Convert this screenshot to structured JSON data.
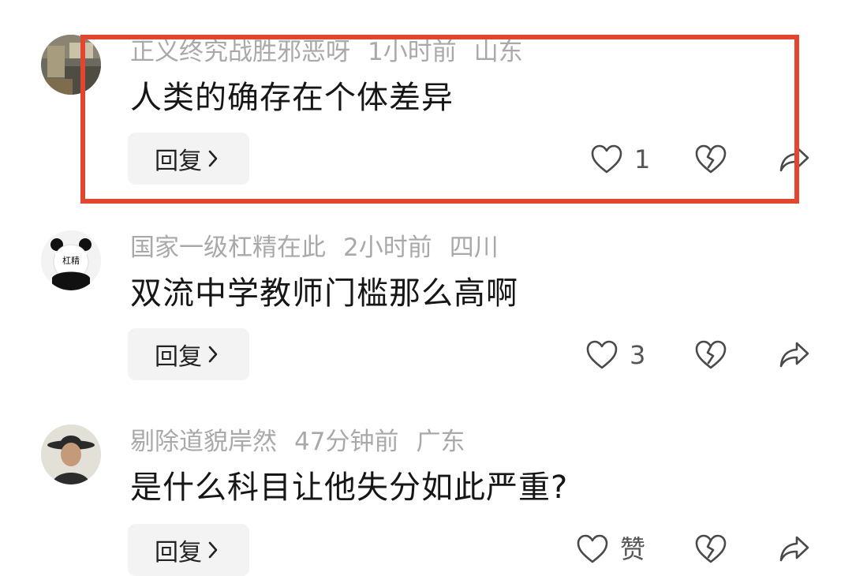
{
  "colors": {
    "highlight": "#e2462e",
    "meta_text": "#a9a9a9",
    "body_text": "#161616",
    "reply_bg": "#f3f3f3"
  },
  "comments": [
    {
      "username": "正义终究战胜邪恶呀",
      "time": "1小时前",
      "location": "山东",
      "text": "人类的确存在个体差异",
      "reply_label": "回复",
      "like_count": "1",
      "icons": [
        "heart-icon",
        "broken-heart-icon",
        "share-icon"
      ]
    },
    {
      "username": "国家一级杠精在此",
      "time": "2小时前",
      "location": "四川",
      "text": "双流中学教师门槛那么高啊",
      "reply_label": "回复",
      "like_count": "3",
      "avatar_text": "杠精",
      "icons": [
        "heart-icon",
        "broken-heart-icon",
        "share-icon"
      ]
    },
    {
      "username": "剔除道貌岸然",
      "time": "47分钟前",
      "location": "广东",
      "text": "是什么科目让他失分如此严重?",
      "reply_label": "回复",
      "like_count": "赞",
      "icons": [
        "heart-icon",
        "broken-heart-icon",
        "share-icon"
      ]
    }
  ]
}
